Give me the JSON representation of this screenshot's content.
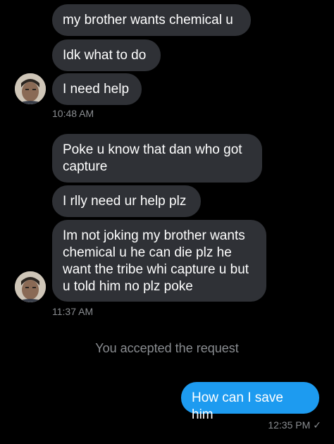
{
  "thread": {
    "group1": {
      "messages": [
        "my brother wants chemical u",
        "Idk what to do",
        "I need help"
      ],
      "timestamp": "10:48 AM"
    },
    "group2": {
      "messages": [
        "Poke u know that dan who got capture",
        "I rlly need ur help plz",
        "Im not joking my brother wants chemical u he can die plz he want the tribe whi capture u but u told him no plz poke"
      ],
      "timestamp": "11:37 AM"
    },
    "system_message": "You accepted the request",
    "outgoing": {
      "message": "How can I save him",
      "timestamp": "12:35 PM",
      "status_icon": "check-icon"
    }
  },
  "colors": {
    "background": "#000000",
    "incoming_bubble": "#2f3136",
    "outgoing_bubble": "#1d9bf0",
    "meta_text": "#8a8d91"
  }
}
